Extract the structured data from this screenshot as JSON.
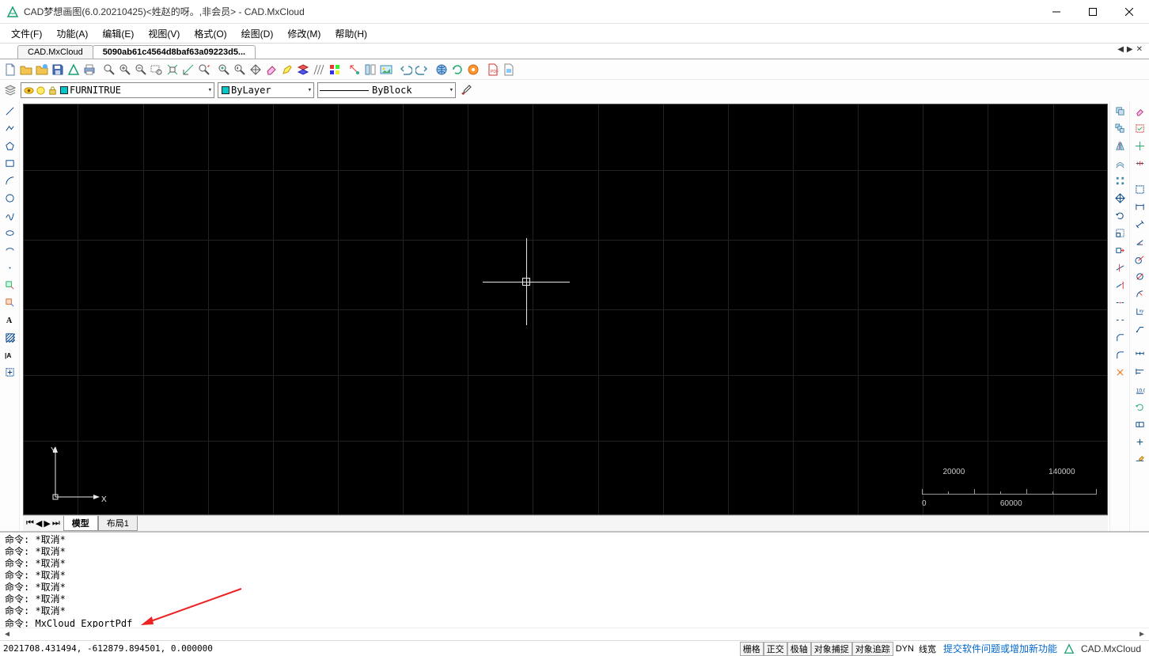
{
  "title": "CAD梦想画图(6.0.20210425)<姓赵的呀。,非会员> - CAD.MxCloud",
  "menus": [
    {
      "label": "文件(F)"
    },
    {
      "label": "功能(A)"
    },
    {
      "label": "编辑(E)"
    },
    {
      "label": "视图(V)"
    },
    {
      "label": "格式(O)"
    },
    {
      "label": "绘图(D)"
    },
    {
      "label": "修改(M)"
    },
    {
      "label": "帮助(H)"
    }
  ],
  "doc_tabs": {
    "inactive": "CAD.MxCloud",
    "active": "5090ab61c4564d8baf63a09223d5..."
  },
  "layer_combo": "FURNITRUE",
  "color_combo": "ByLayer",
  "linetype_combo": "ByBlock",
  "layout_tabs": {
    "model": "模型",
    "layout1": "布局1"
  },
  "scale_ticks": {
    "end": "140000",
    "mid1": "20000",
    "low0": "0",
    "low1": "60000"
  },
  "cmd_log": [
    "命令: *取消*",
    "命令: *取消*",
    "命令: *取消*",
    "命令: *取消*",
    "命令: *取消*",
    "命令: *取消*",
    "命令: *取消*"
  ],
  "cmd_prompt": "命令:",
  "cmd_input": "MxCloud_ExportPdf",
  "status": {
    "coords": "2021708.431494,  -612879.894501,  0.000000",
    "toggles": [
      "栅格",
      "正交",
      "极轴",
      "对象捕捉",
      "对象追踪",
      "DYN",
      "线宽"
    ],
    "link": "提交软件问题或增加新功能",
    "brand": "CAD.MxCloud"
  }
}
